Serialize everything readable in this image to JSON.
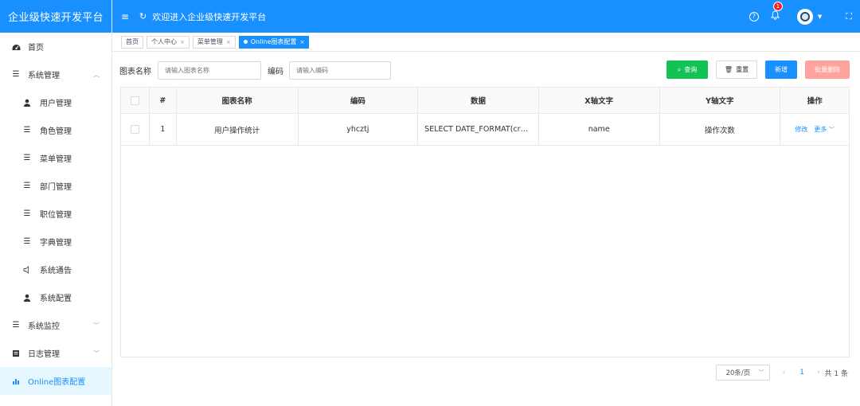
{
  "app": {
    "title": "企业级快速开发平台"
  },
  "header": {
    "welcome": "欢迎进入企业级快速开发平台",
    "notification_count": "1",
    "brand_color": "#1890ff"
  },
  "sidebar": {
    "items": [
      {
        "label": "首页",
        "icon": "dashboard-icon"
      },
      {
        "label": "系统管理",
        "icon": "list-icon",
        "expanded": true
      },
      {
        "label": "用户管理",
        "icon": "user-icon"
      },
      {
        "label": "角色管理",
        "icon": "list-icon"
      },
      {
        "label": "菜单管理",
        "icon": "list-icon"
      },
      {
        "label": "部门管理",
        "icon": "list-icon"
      },
      {
        "label": "职位管理",
        "icon": "list-icon"
      },
      {
        "label": "字典管理",
        "icon": "list-icon"
      },
      {
        "label": "系统通告",
        "icon": "speaker-icon"
      },
      {
        "label": "系统配置",
        "icon": "user-icon"
      },
      {
        "label": "系统监控",
        "icon": "list-icon"
      },
      {
        "label": "日志管理",
        "icon": "log-icon"
      },
      {
        "label": "Online图表配置",
        "icon": "bar-chart-icon",
        "active": true
      }
    ]
  },
  "tags": [
    {
      "label": "首页"
    },
    {
      "label": "个人中心"
    },
    {
      "label": "菜单管理"
    },
    {
      "label": "Online图表配置",
      "active": true
    }
  ],
  "search": {
    "name_label": "图表名称",
    "name_placeholder": "请输入图表名称",
    "code_label": "编码",
    "code_placeholder": "请输入编码"
  },
  "buttons": {
    "query": "查询",
    "reset": "重置",
    "add": "新增",
    "batch_delete": "批量删除"
  },
  "table": {
    "columns": [
      "#",
      "图表名称",
      "编码",
      "数据",
      "X轴文字",
      "Y轴文字",
      "操作"
    ],
    "rows": [
      {
        "index": "1",
        "name": "用户操作统计",
        "code": "yhcztj",
        "data": "SELECT DATE_FORMAT(cr…",
        "x_text": "name",
        "y_text": "操作次数",
        "edit": "修改",
        "more": "更多"
      }
    ]
  },
  "pagination": {
    "page_size": "20条/页",
    "current_page": "1",
    "total": "共 1 条"
  }
}
